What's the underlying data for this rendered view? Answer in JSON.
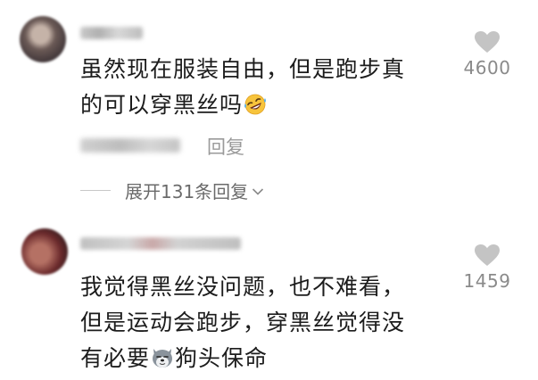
{
  "comments": [
    {
      "text_part1": "虽然现在服装自由，但是跑步真",
      "text_part2": "的可以穿黑丝吗",
      "emoji": "rolling-on-floor-laughing-icon",
      "likes": "4600",
      "reply_label": "回复",
      "expand_label": "展开131条回复"
    },
    {
      "text_part1": "我觉得黑丝没问题，也不难看，",
      "text_part2": "但是运动会跑步，穿黑丝觉得没",
      "text_part3": "有必要",
      "emoji": "dog-head-icon",
      "text_tail": "狗头保命",
      "likes": "1459"
    }
  ],
  "colors": {
    "text": "#1c1c1c",
    "muted": "#8a8a8a",
    "like_icon": "#c4c4c4"
  }
}
